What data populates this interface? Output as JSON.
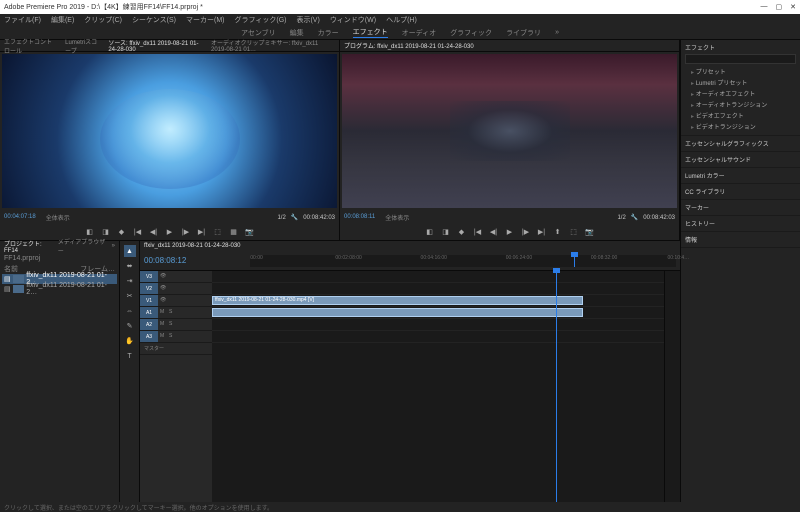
{
  "titlebar": {
    "title": "Adobe Premiere Pro 2019 - D:\\【4K】練習用FF14\\FF14.prproj *"
  },
  "menu": {
    "items": [
      "ファイル(F)",
      "編集(E)",
      "クリップ(C)",
      "シーケンス(S)",
      "マーカー(M)",
      "グラフィック(G)",
      "表示(V)",
      "ウィンドウ(W)",
      "ヘルプ(H)"
    ]
  },
  "workspaces": {
    "items": [
      "アセンブリ",
      "編集",
      "カラー",
      "エフェクト",
      "オーディオ",
      "グラフィック",
      "ライブラリ"
    ],
    "active": 3
  },
  "source": {
    "tabs": [
      "エフェクトコントロール",
      "Lumetriスコープ",
      "ソース: ffxiv_dx11 2019-08-21 01-24-28-030",
      "オーディオクリップミキサー: ffxiv_dx11 2019-08-21 01…"
    ],
    "active_tab": 2,
    "tc_left": "00:04:07:18",
    "tc_right": "00:08:42:03",
    "fit_label": "全体表示",
    "scale_label": "1/2"
  },
  "program": {
    "tab": "プログラム: ffxiv_dx11 2019-08-21 01-24-28-030",
    "tc_left": "00:08:08:11",
    "tc_right": "00:08:42:03",
    "fit_label": "全体表示",
    "scale_label": "1/2"
  },
  "project": {
    "tabs": [
      "プロジェクト: FF14",
      "メディアブラウザー"
    ],
    "name": "FF14.prproj",
    "columns": [
      "名前",
      "フレーム…"
    ],
    "items": [
      {
        "name": "ffxiv_dx11 2019-08-21 01-2…",
        "selected": true
      },
      {
        "name": "ffxiv_dx11 2019-08-21 01-2…",
        "selected": false
      }
    ]
  },
  "timeline": {
    "sequence_name": "ffxiv_dx11 2019-08-21 01-24-28-030",
    "tc": "00:08:08:12",
    "ruler": [
      "00:00",
      "00:02:08:00",
      "00:04:16:00",
      "00:06:24:00",
      "00:08:32:00",
      "00:10:4…"
    ],
    "tracks_v": [
      "V3",
      "V2",
      "V1"
    ],
    "tracks_a": [
      "A1",
      "A2",
      "A3"
    ],
    "master_label": "マスター",
    "clip_name": "ffxiv_dx11 2019-08-21 01-24-28-030.mp4 [V]"
  },
  "effects": {
    "title": "エフェクト",
    "search_placeholder": "",
    "folders": [
      "プリセット",
      "Lumetri プリセット",
      "オーディオエフェクト",
      "オーディオトランジション",
      "ビデオエフェクト",
      "ビデオトランジション"
    ],
    "panels": [
      "エッセンシャルグラフィックス",
      "エッセンシャルサウンド",
      "Lumetri カラー",
      "CC ライブラリ",
      "マーカー",
      "ヒストリー",
      "情報"
    ]
  },
  "statusbar": {
    "text": "クリックして選択、または空のエリアをクリックしてマーキー選択。他のオプションを使用します。"
  }
}
